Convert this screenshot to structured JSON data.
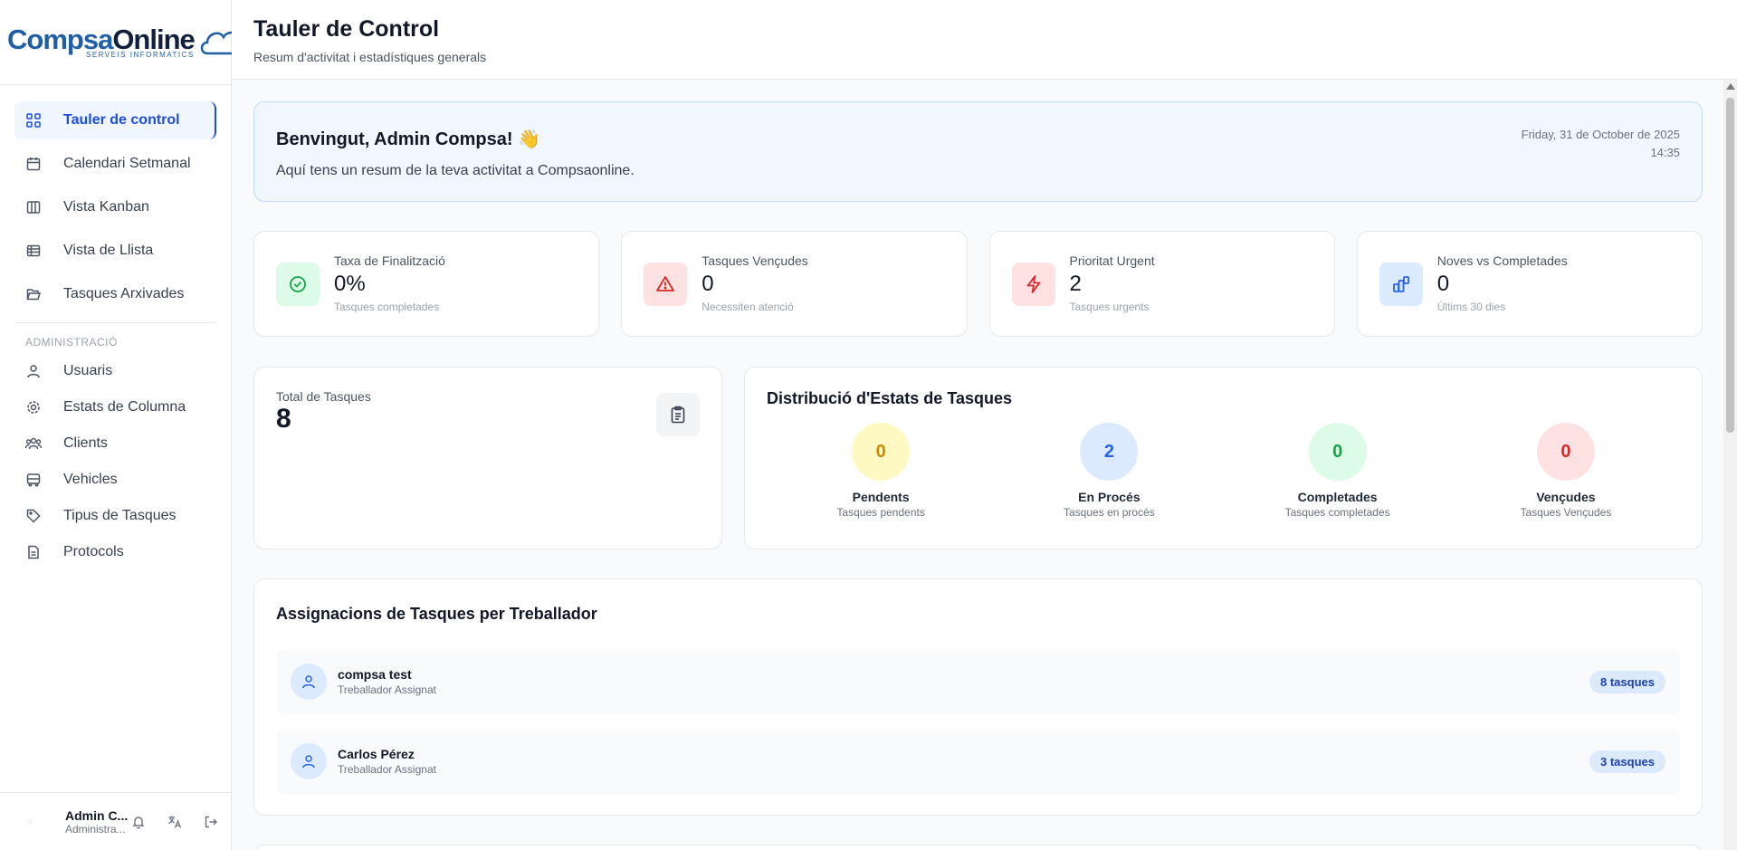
{
  "brand": {
    "name_part1": "Compsa",
    "name_part2": "Online",
    "tagline": "SERVEIS INFORMATICS",
    "primary": "#1f5fa8",
    "dark": "#0f1f3d"
  },
  "sidebar": {
    "main_items": [
      {
        "label": "Tauler de control",
        "icon": "grid-icon",
        "active": true
      },
      {
        "label": "Calendari Setmanal",
        "icon": "calendar-icon"
      },
      {
        "label": "Vista Kanban",
        "icon": "kanban-icon"
      },
      {
        "label": "Vista de Llista",
        "icon": "list-table-icon"
      },
      {
        "label": "Tasques Arxivades",
        "icon": "folder-open-icon"
      }
    ],
    "section_title": "ADMINISTRACIÓ",
    "admin_items": [
      {
        "label": "Usuaris",
        "icon": "user-icon"
      },
      {
        "label": "Estats de Columna",
        "icon": "gear-icon"
      },
      {
        "label": "Clients",
        "icon": "users-icon"
      },
      {
        "label": "Vehicles",
        "icon": "bus-icon"
      },
      {
        "label": "Tipus de Tasques",
        "icon": "tag-icon"
      },
      {
        "label": "Protocols",
        "icon": "document-icon"
      }
    ],
    "user": {
      "name": "Admin C...",
      "role": "Administra...",
      "actions": [
        "bell-icon",
        "translate-icon",
        "logout-icon"
      ]
    }
  },
  "header": {
    "title": "Tauler de Control",
    "subtitle": "Resum d'activitat i estadístiques generals"
  },
  "welcome": {
    "title": "Benvingut, Admin Compsa! 👋",
    "message": "Aquí tens un resum de la teva activitat a Compsaonline.",
    "date": "Friday, 31 de October de 2025",
    "time": "14:35"
  },
  "stats": [
    {
      "label": "Taxa de Finalització",
      "value": "0%",
      "hint": "Tasques completades",
      "icon": "check-circle-icon",
      "bg": "#dcfce7",
      "fg": "#16a34a"
    },
    {
      "label": "Tasques Vençudes",
      "value": "0",
      "hint": "Necessiten atenció",
      "icon": "alert-triangle-icon",
      "bg": "#fee2e2",
      "fg": "#dc2626"
    },
    {
      "label": "Prioritat Urgent",
      "value": "2",
      "hint": "Tasques urgents",
      "icon": "lightning-icon",
      "bg": "#fee2e2",
      "fg": "#dc2626"
    },
    {
      "label": "Noves vs Completades",
      "value": "0",
      "hint": "Últims 30 dies",
      "icon": "bar-chart-icon",
      "bg": "#dbeafe",
      "fg": "#2563eb"
    }
  ],
  "total": {
    "label": "Total de Tasques",
    "value": "8",
    "icon": "clipboard-icon"
  },
  "distribution": {
    "title": "Distribució d'Estats de Tasques",
    "items": [
      {
        "count": "0",
        "name": "Pendents",
        "desc": "Tasques pendents",
        "bg": "#fef9c3",
        "fg": "#ca8a04"
      },
      {
        "count": "2",
        "name": "En Procés",
        "desc": "Tasques en procés",
        "bg": "#dbeafe",
        "fg": "#2563eb"
      },
      {
        "count": "0",
        "name": "Completades",
        "desc": "Tasques completades",
        "bg": "#dcfce7",
        "fg": "#16a34a"
      },
      {
        "count": "0",
        "name": "Vençudes",
        "desc": "Tasques Vençudes",
        "bg": "#fee2e2",
        "fg": "#dc2626"
      }
    ]
  },
  "assignments": {
    "title": "Assignacions de Tasques per Treballador",
    "workers": [
      {
        "name": "compsa test",
        "role": "Treballador Assignat",
        "count": "8 tasques"
      },
      {
        "name": "Carlos Pérez",
        "role": "Treballador Assignat",
        "count": "3 tasques"
      }
    ]
  }
}
